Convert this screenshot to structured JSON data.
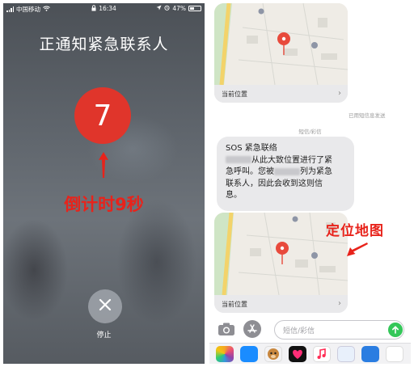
{
  "left": {
    "status": {
      "carrier": "中国移动",
      "time": "16:34",
      "battery": "47%"
    },
    "title": "正通知紧急联系人",
    "countdown_number": "7",
    "countdown_label": "倒计时9秒",
    "stop_label": "停止"
  },
  "right": {
    "map_caption_top": "当前位置",
    "delivered_note": "已用短信息发送",
    "thread_label": "短信/彩信",
    "message": {
      "line1": "SOS 紧急联络",
      "line2_after": "从此大致位置进行了紧",
      "line3_pre": "急呼叫。您被",
      "line3_after": "列为紧急",
      "line4": "联系人，因此会收到这则信",
      "line5": "息。"
    },
    "map_caption_bottom": "当前位置",
    "map_annotation": "定位地图",
    "input_placeholder": "短信/彩信"
  },
  "colors": {
    "accent_red": "#e8231b",
    "countdown_circle": "#e0352b",
    "send_green": "#34c759",
    "pin_red": "#e84a3c"
  }
}
